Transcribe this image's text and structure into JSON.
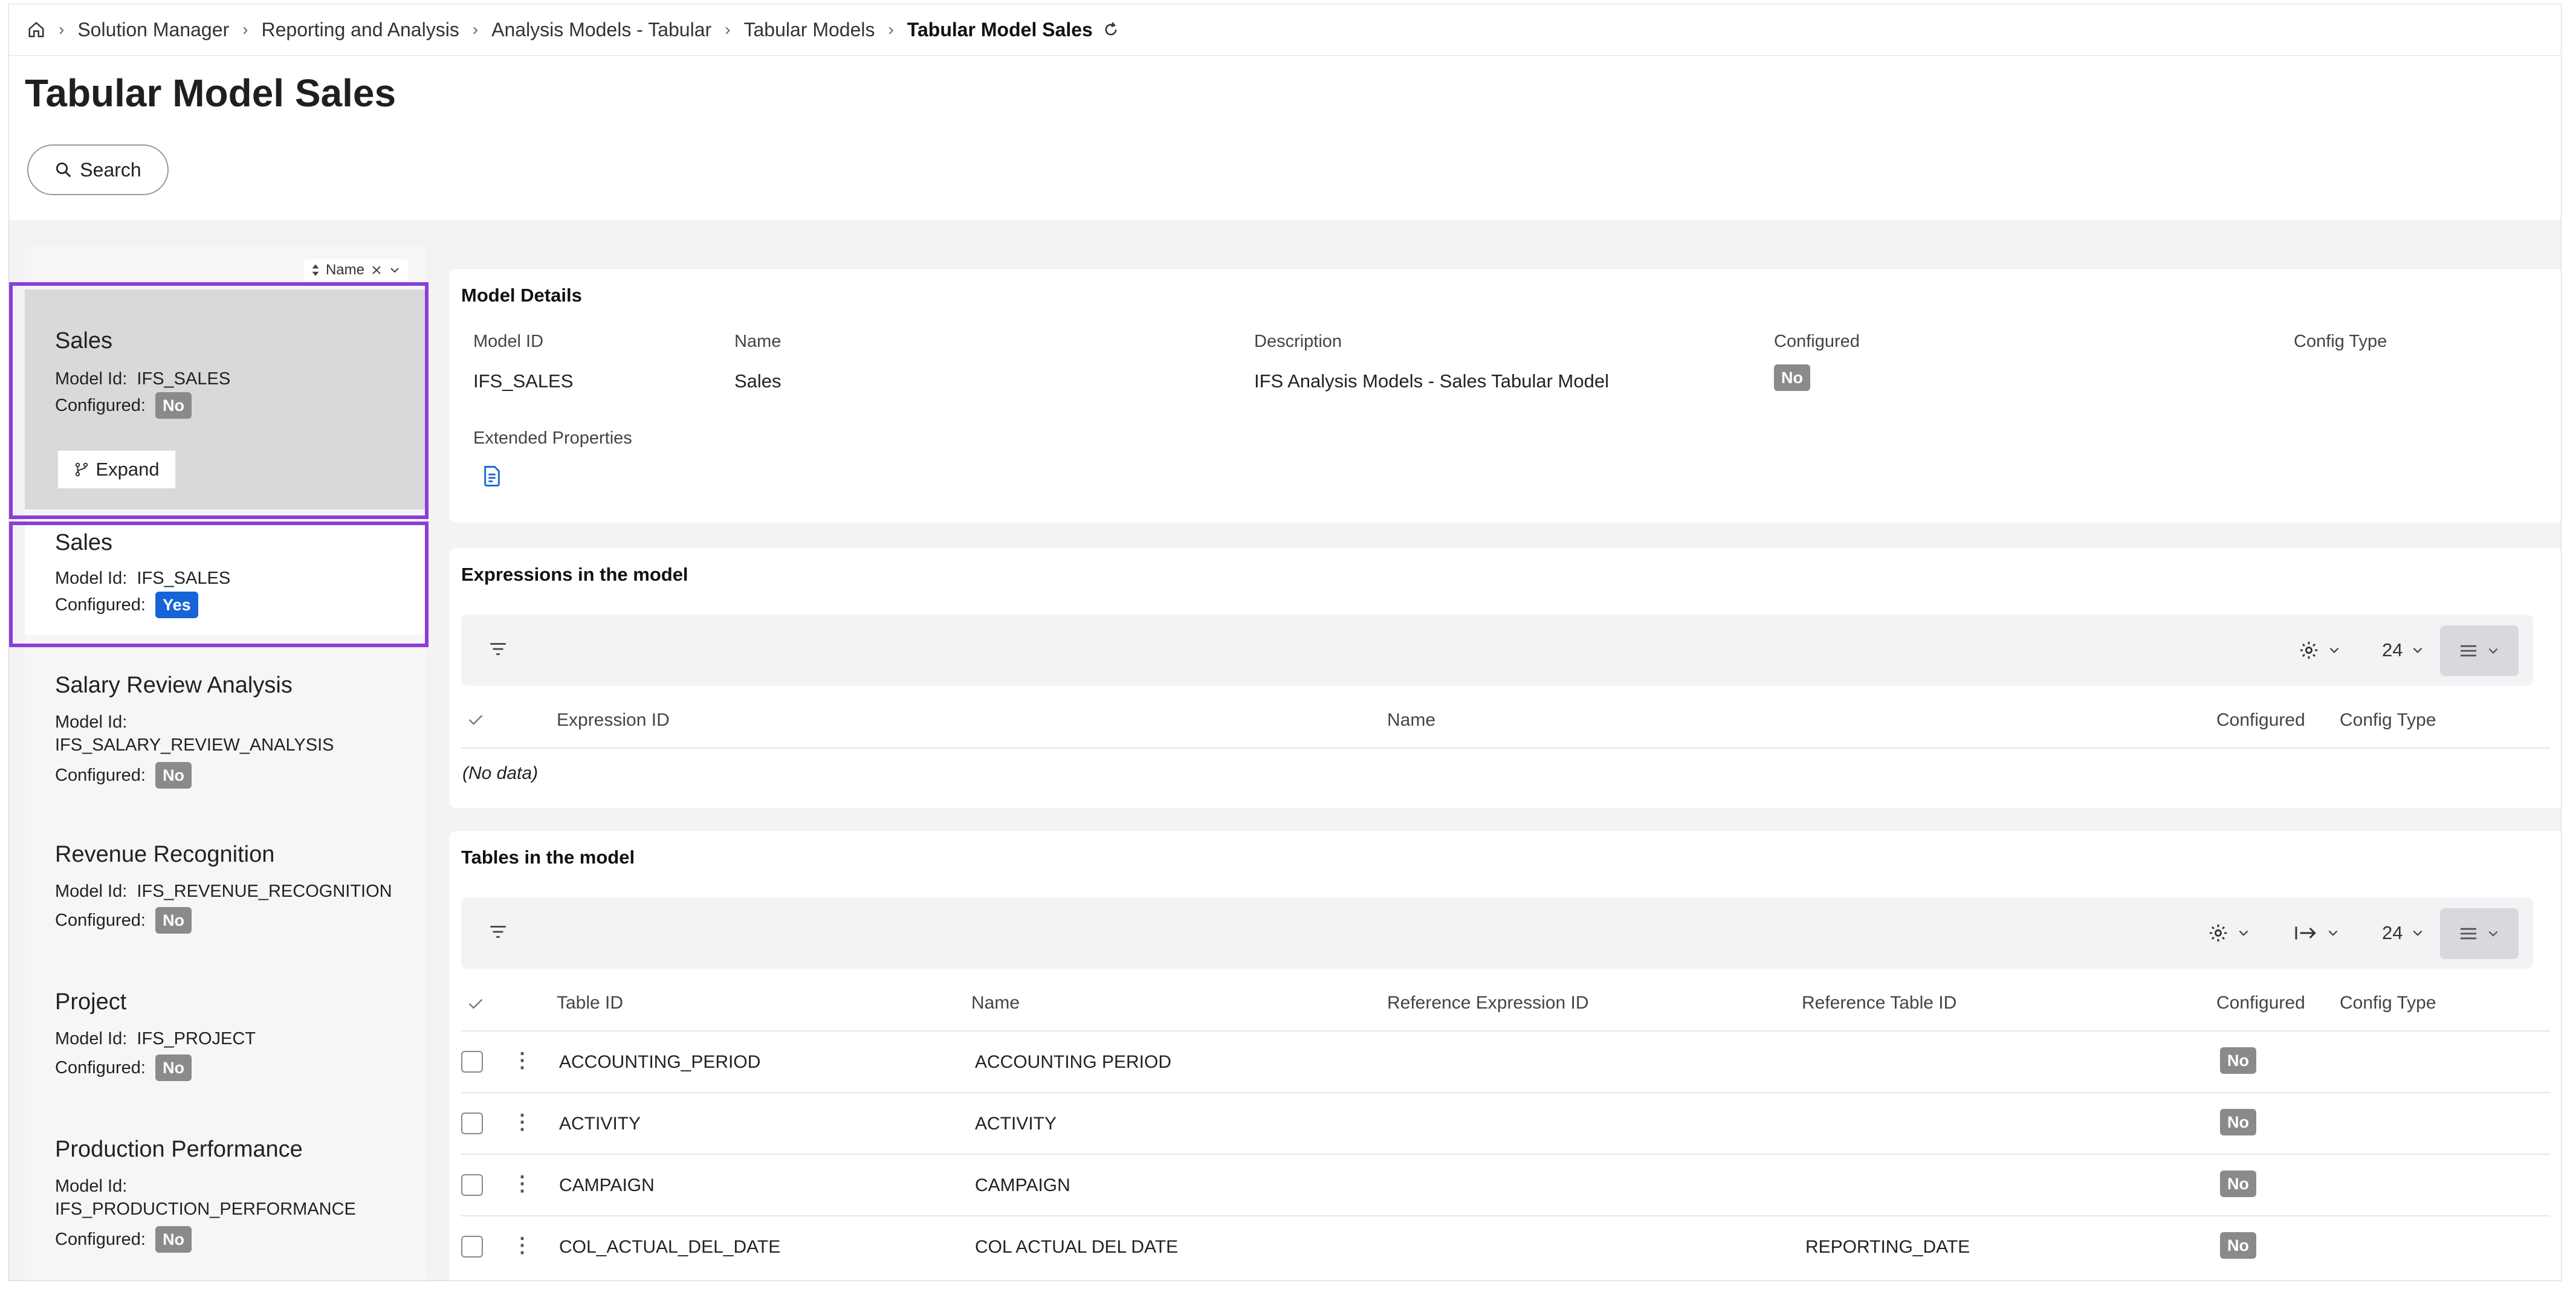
{
  "breadcrumb": {
    "items": [
      "Solution Manager",
      "Reporting and Analysis",
      "Analysis Models - Tabular",
      "Tabular Models"
    ],
    "current": "Tabular Model Sales"
  },
  "page": {
    "title": "Tabular Model Sales",
    "search_label": "Search"
  },
  "list": {
    "sort_label": "Name",
    "model_id_label": "Model Id:",
    "configured_label": "Configured:",
    "expand_label": "Expand",
    "items": [
      {
        "name": "Sales",
        "model_id": "IFS_SALES",
        "configured": "No"
      },
      {
        "name": "Sales",
        "model_id": "IFS_SALES",
        "configured": "Yes"
      },
      {
        "name": "Salary Review Analysis",
        "model_id": "IFS_SALARY_REVIEW_ANALYSIS",
        "configured": "No"
      },
      {
        "name": "Revenue Recognition",
        "model_id": "IFS_REVENUE_RECOGNITION",
        "configured": "No"
      },
      {
        "name": "Project",
        "model_id": "IFS_PROJECT",
        "configured": "No"
      },
      {
        "name": "Production Performance",
        "model_id": "IFS_PRODUCTION_PERFORMANCE",
        "configured": "No"
      }
    ]
  },
  "details": {
    "title": "Model Details",
    "labels": {
      "model_id": "Model ID",
      "name": "Name",
      "description": "Description",
      "configured": "Configured",
      "config_type": "Config Type",
      "extended": "Extended Properties"
    },
    "values": {
      "model_id": "IFS_SALES",
      "name": "Sales",
      "description": "IFS Analysis Models - Sales Tabular Model",
      "configured": "No"
    }
  },
  "expressions": {
    "title": "Expressions in the model",
    "page_size": "24",
    "columns": [
      "Expression ID",
      "Name",
      "Configured",
      "Config Type"
    ],
    "empty": "(No data)"
  },
  "tables": {
    "title": "Tables in the model",
    "page_size": "24",
    "columns": [
      "Table ID",
      "Name",
      "Reference Expression ID",
      "Reference Table ID",
      "Configured",
      "Config Type"
    ],
    "rows": [
      {
        "table_id": "ACCOUNTING_PERIOD",
        "name": "ACCOUNTING PERIOD",
        "ref_expr": "",
        "ref_table": "",
        "configured": "No",
        "config_type": ""
      },
      {
        "table_id": "ACTIVITY",
        "name": "ACTIVITY",
        "ref_expr": "",
        "ref_table": "",
        "configured": "No",
        "config_type": ""
      },
      {
        "table_id": "CAMPAIGN",
        "name": "CAMPAIGN",
        "ref_expr": "",
        "ref_table": "",
        "configured": "No",
        "config_type": ""
      },
      {
        "table_id": "COL_ACTUAL_DEL_DATE",
        "name": "COL ACTUAL DEL DATE",
        "ref_expr": "",
        "ref_table": "REPORTING_DATE",
        "configured": "No",
        "config_type": ""
      }
    ]
  },
  "colors": {
    "highlight": "#8a3ed8",
    "badge_yes": "#1565d8",
    "badge_no": "#8a8a8a"
  },
  "icons": [
    "home-icon",
    "refresh-icon",
    "search-icon",
    "sort-icon",
    "clear-icon",
    "chevron-down-icon",
    "branch-icon",
    "document-icon",
    "filter-icon",
    "gear-icon",
    "column-arrow-icon",
    "list-view-icon",
    "check-icon",
    "more-icon"
  ]
}
